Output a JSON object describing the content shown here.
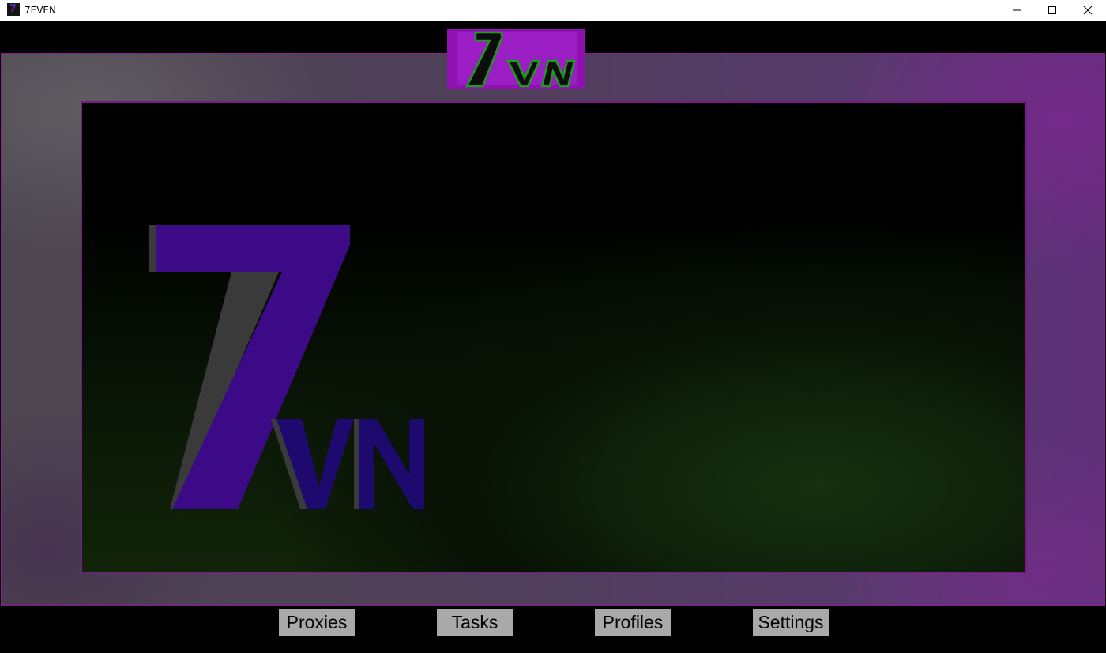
{
  "window": {
    "title": "7EVEN",
    "icon": "app-icon",
    "controls": [
      "minimize-icon",
      "maximize-icon",
      "close-icon"
    ]
  },
  "branding": {
    "logo_text": "7VN",
    "accent_color": "#9b1ec4",
    "logo_purple": "#3c0a86",
    "logo_green": "#17a017"
  },
  "nav": {
    "items": [
      {
        "label": "Proxies"
      },
      {
        "label": "Tasks"
      },
      {
        "label": "Profiles"
      },
      {
        "label": "Settings"
      }
    ]
  }
}
